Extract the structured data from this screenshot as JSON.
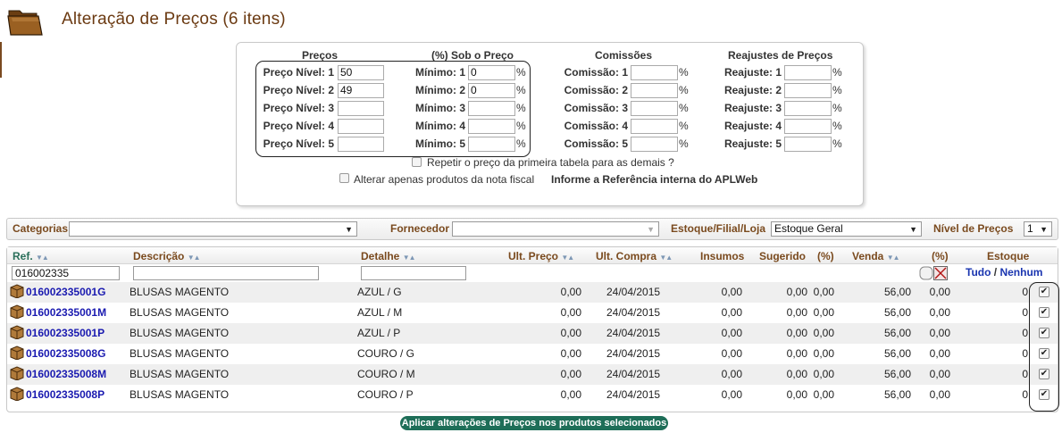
{
  "header": {
    "title": "Alteração de Preços (6 itens)",
    "icon": "folder-icon"
  },
  "panel": {
    "columns": {
      "precos": "Preços",
      "sob_preco": "(%) Sob o Preço",
      "comissoes": "Comissões",
      "reajustes": "Reajustes de Preços"
    },
    "preco_labels": [
      "Preço Nível: 1",
      "Preço Nível: 2",
      "Preço Nível: 3",
      "Preço Nível: 4",
      "Preço Nível: 5"
    ],
    "preco_values": [
      "50",
      "49",
      "",
      "",
      ""
    ],
    "minimo_labels": [
      "Mínimo: 1",
      "Mínimo: 2",
      "Mínimo: 3",
      "Mínimo: 4",
      "Mínimo: 5"
    ],
    "minimo_values": [
      "0",
      "0",
      "",
      "",
      ""
    ],
    "comissao_labels": [
      "Comissão: 1",
      "Comissão: 2",
      "Comissão: 3",
      "Comissão: 4",
      "Comissão: 5"
    ],
    "comissao_values": [
      "",
      "",
      "",
      "",
      ""
    ],
    "reajuste_labels": [
      "Reajuste: 1",
      "Reajuste: 2",
      "Reajuste: 3",
      "Reajuste: 4",
      "Reajuste: 5"
    ],
    "reajuste_values": [
      "",
      "",
      "",
      "",
      ""
    ],
    "pct": "%",
    "repeat_label": "Repetir o preço da primeira tabela para as demais ?",
    "nota_label": "Alterar apenas produtos da nota fiscal",
    "ref_hint": "Informe a Referência interna do APLWeb"
  },
  "filters": {
    "categorias_label": "Categorias",
    "categorias_value": "",
    "fornecedor_label": "Fornecedor",
    "fornecedor_value": "",
    "estoque_label": "Estoque/Filial/Loja",
    "estoque_value": "Estoque Geral",
    "nivel_label": "Nível de Preços",
    "nivel_value": "1"
  },
  "table": {
    "headers": {
      "ref": "Ref.",
      "descricao": "Descrição",
      "detalhe": "Detalhe",
      "ult_preco": "Ult. Preço",
      "ult_compra": "Ult. Compra",
      "insumos": "Insumos",
      "sugerido": "Sugerido",
      "pct1": "(%)",
      "venda": "Venda",
      "pct2": "(%)",
      "estoque": "Estoque"
    },
    "filter_ref": "016002335",
    "filter_desc": "",
    "filter_detalhe": "",
    "select_all": "Tudo",
    "separator": "/",
    "select_none": "Nenhum",
    "rows": [
      {
        "ref": "016002335001G",
        "descricao": "BLUSAS MAGENTO",
        "detalhe": "AZUL / G",
        "ult_preco": "0,00",
        "ult_compra": "24/04/2015",
        "insumos": "0,00",
        "sugerido": "0,00",
        "pct1": "0,00",
        "venda": "56,00",
        "pct2": "0,00",
        "estoque": "0",
        "checked": true
      },
      {
        "ref": "016002335001M",
        "descricao": "BLUSAS MAGENTO",
        "detalhe": "AZUL / M",
        "ult_preco": "0,00",
        "ult_compra": "24/04/2015",
        "insumos": "0,00",
        "sugerido": "0,00",
        "pct1": "0,00",
        "venda": "56,00",
        "pct2": "0,00",
        "estoque": "0",
        "checked": true
      },
      {
        "ref": "016002335001P",
        "descricao": "BLUSAS MAGENTO",
        "detalhe": "AZUL / P",
        "ult_preco": "0,00",
        "ult_compra": "24/04/2015",
        "insumos": "0,00",
        "sugerido": "0,00",
        "pct1": "0,00",
        "venda": "56,00",
        "pct2": "0,00",
        "estoque": "0",
        "checked": true
      },
      {
        "ref": "016002335008G",
        "descricao": "BLUSAS MAGENTO",
        "detalhe": "COURO / G",
        "ult_preco": "0,00",
        "ult_compra": "24/04/2015",
        "insumos": "0,00",
        "sugerido": "0,00",
        "pct1": "0,00",
        "venda": "56,00",
        "pct2": "0,00",
        "estoque": "0",
        "checked": true
      },
      {
        "ref": "016002335008M",
        "descricao": "BLUSAS MAGENTO",
        "detalhe": "COURO / M",
        "ult_preco": "0,00",
        "ult_compra": "24/04/2015",
        "insumos": "0,00",
        "sugerido": "0,00",
        "pct1": "0,00",
        "venda": "56,00",
        "pct2": "0,00",
        "estoque": "0",
        "checked": true
      },
      {
        "ref": "016002335008P",
        "descricao": "BLUSAS MAGENTO",
        "detalhe": "COURO / P",
        "ult_preco": "0,00",
        "ult_compra": "24/04/2015",
        "insumos": "0,00",
        "sugerido": "0,00",
        "pct1": "0,00",
        "venda": "56,00",
        "pct2": "0,00",
        "estoque": "0",
        "checked": true
      }
    ]
  },
  "apply_button": "Aplicar alterações de Preços nos produtos selecionados",
  "colors": {
    "title": "#6b3a12",
    "header_label": "#7a4a1e",
    "link": "#1a1ab0",
    "button": "#1e6e58"
  }
}
